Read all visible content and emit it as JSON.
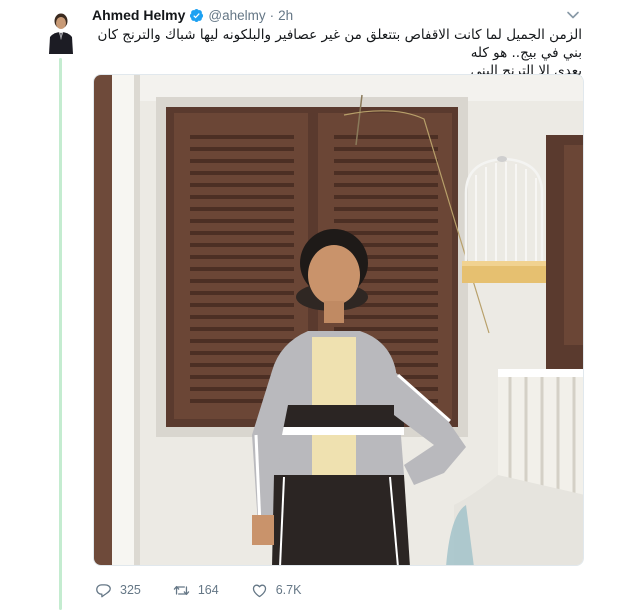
{
  "tweet": {
    "author_name": "Ahmed Helmy",
    "handle": "@ahelmy",
    "separator": "·",
    "time": "2h",
    "text_line1": "الزمن الجميل لما كانت الاقفاص بتتعلق من غير عصافير والبلكونه ليها شباك والترنج كان بني في بيج.. هو كله",
    "text_line2": "يعدي الا الترنج البني",
    "verified": true
  },
  "actions": {
    "replies": "325",
    "retweets": "164",
    "likes": "6.7K"
  },
  "icons": {
    "verified": "verified-badge-icon",
    "caret": "chevron-down-icon",
    "reply": "reply-icon",
    "retweet": "retweet-icon",
    "like": "heart-icon"
  },
  "colors": {
    "verified_blue": "#1da1f2",
    "muted_text": "#657786",
    "thread_line": "#c4ecd0"
  }
}
